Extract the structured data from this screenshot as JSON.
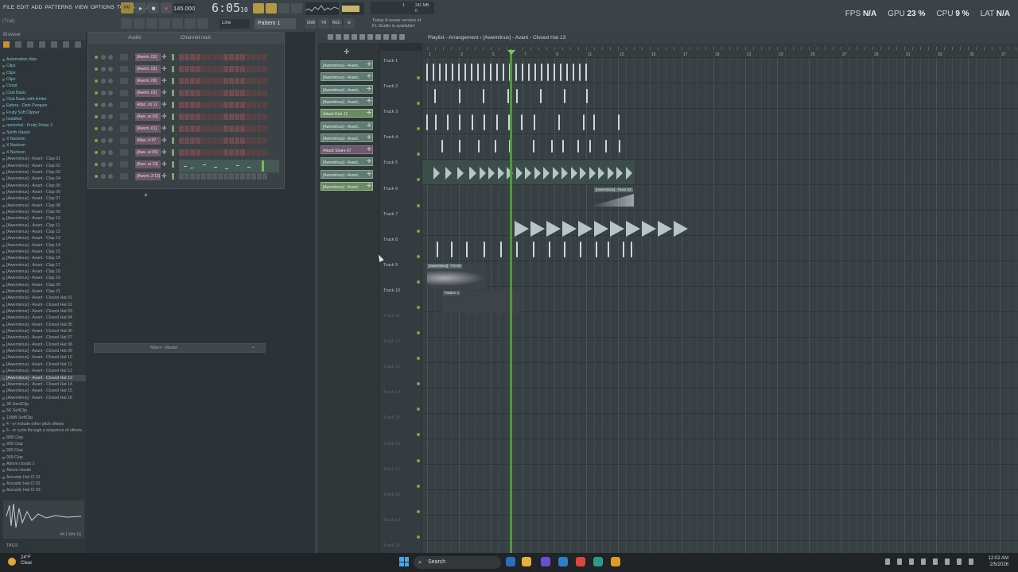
{
  "menu": [
    "FILE",
    "EDIT",
    "ADD",
    "PATTERNS",
    "VIEW",
    "OPTIONS",
    "TOOLS",
    "HELP"
  ],
  "hint": "(Trial)",
  "tempo": "145.000",
  "time_main": "6:05",
  "time_sub": "10",
  "cpu_voices": "1",
  "cpu_mem": "241 MB",
  "cpu_poly": "0",
  "line_mode": "Line",
  "pattern": "Pattern 1",
  "snap_labels": [
    "SNR",
    "TR",
    "REC"
  ],
  "notice_line1": "Today  A newer version of",
  "notice_line2": "FL Studio is available!",
  "stats": {
    "fps_label": "FPS",
    "fps": "N/A",
    "gpu_label": "GPU",
    "gpu": "23 %",
    "cpu_label": "CPU",
    "cpu": "9 %",
    "lat_label": "LAT",
    "lat": "N/A"
  },
  "browser": {
    "title": "Browser",
    "items": [
      {
        "t": "Automation clips",
        "k": "folder"
      },
      {
        "t": "Clips",
        "k": "folder"
      },
      {
        "t": "Clips",
        "k": "folder"
      },
      {
        "t": "Clips",
        "k": "folder"
      },
      {
        "t": "Cloud",
        "k": "folder"
      },
      {
        "t": "Club Basic",
        "k": "folder"
      },
      {
        "t": "Club Basic with limiter",
        "k": "folder"
      },
      {
        "t": "Eptera - Dark Penguin",
        "k": "folder"
      },
      {
        "t": "Fruity Soft Clipper",
        "k": "folder"
      },
      {
        "t": "Installed",
        "k": "folder"
      },
      {
        "t": "nocturnal - Fruity Delay 3",
        "k": "folder"
      },
      {
        "t": "Synth classic",
        "k": "folder"
      },
      {
        "t": "X Nucleon",
        "k": "folder"
      },
      {
        "t": "X Nucleon",
        "k": "folder"
      },
      {
        "t": "X Nucleon",
        "k": "folder"
      },
      {
        "t": "[Awemiinus] - Avant - Clap 01",
        "k": "file"
      },
      {
        "t": "[Awemiinus] - Avant - Clap 02",
        "k": "file"
      },
      {
        "t": "[Awemiinus] - Avant - Clap 03",
        "k": "file"
      },
      {
        "t": "[Awemiinus] - Avant - Clap 04",
        "k": "file"
      },
      {
        "t": "[Awemiinus] - Avant - Clap 05",
        "k": "file"
      },
      {
        "t": "[Awemiinus] - Avant - Clap 06",
        "k": "file"
      },
      {
        "t": "[Awemiinus] - Avant - Clap 07",
        "k": "file"
      },
      {
        "t": "[Awemiinus] - Avant - Clap 08",
        "k": "file"
      },
      {
        "t": "[Awemiinus] - Avant - Clap 09",
        "k": "file"
      },
      {
        "t": "[Awemiinus] - Avant - Clap 10",
        "k": "file"
      },
      {
        "t": "[Awemiinus] - Avant - Clap 11",
        "k": "file"
      },
      {
        "t": "[Awemiinus] - Avant - Clap 12",
        "k": "file"
      },
      {
        "t": "[Awemiinus] - Avant - Clap 13",
        "k": "file"
      },
      {
        "t": "[Awemiinus] - Avant - Clap 14",
        "k": "file"
      },
      {
        "t": "[Awemiinus] - Avant - Clap 15",
        "k": "file"
      },
      {
        "t": "[Awemiinus] - Avant - Clap 16",
        "k": "file"
      },
      {
        "t": "[Awemiinus] - Avant - Clap 17",
        "k": "file"
      },
      {
        "t": "[Awemiinus] - Avant - Clap 18",
        "k": "file"
      },
      {
        "t": "[Awemiinus] - Avant - Clap 19",
        "k": "file"
      },
      {
        "t": "[Awemiinus] - Avant - Clap 20",
        "k": "file"
      },
      {
        "t": "[Awemiinus] - Avant - Clap 21",
        "k": "file"
      },
      {
        "t": "[Awemiinus] - Avant - Closed Hat 01",
        "k": "file"
      },
      {
        "t": "[Awemiinus] - Avant - Closed Hat 02",
        "k": "file"
      },
      {
        "t": "[Awemiinus] - Avant - Closed Hat 03",
        "k": "file"
      },
      {
        "t": "[Awemiinus] - Avant - Closed Hat 04",
        "k": "file"
      },
      {
        "t": "[Awemiinus] - Avant - Closed Hat 05",
        "k": "file"
      },
      {
        "t": "[Awemiinus] - Avant - Closed Hat 06",
        "k": "file"
      },
      {
        "t": "[Awemiinus] - Avant - Closed Hat 07",
        "k": "file"
      },
      {
        "t": "[Awemiinus] - Avant - Closed Hat 08",
        "k": "file"
      },
      {
        "t": "[Awemiinus] - Avant - Closed Hat 09",
        "k": "file"
      },
      {
        "t": "[Awemiinus] - Avant - Closed Hat 10",
        "k": "file"
      },
      {
        "t": "[Awemiinus] - Avant - Closed Hat 11",
        "k": "file"
      },
      {
        "t": "[Awemiinus] - Avant - Closed Hat 12",
        "k": "file"
      },
      {
        "t": "[Awemiinus] - Avant - Closed Hat 13",
        "k": "sel"
      },
      {
        "t": "[Awemiinus] - Avant - Closed Hat 14",
        "k": "file"
      },
      {
        "t": "[Awemiinus] - Avant - Closed Hat 15",
        "k": "file"
      },
      {
        "t": "[Awemiinus] - Avant - Closed Hat 16",
        "k": "file"
      },
      {
        "t": "3K HardClip",
        "k": "file"
      },
      {
        "t": "5K SoftClip",
        "k": "file"
      },
      {
        "t": "10MB SoftClip",
        "k": "file"
      },
      {
        "t": "4 - or include other pitch offsets",
        "k": "file"
      },
      {
        "t": "5 - or cycle through a sequence of offsets",
        "k": "file"
      },
      {
        "t": "808 Clap",
        "k": "file"
      },
      {
        "t": "909 Clap",
        "k": "file"
      },
      {
        "t": "909 Clap",
        "k": "file"
      },
      {
        "t": "909 Clap",
        "k": "file"
      },
      {
        "t": "Above clouds 2",
        "k": "file"
      },
      {
        "t": "Above clouds",
        "k": "file"
      },
      {
        "t": "Acoustic Hat Cl 01",
        "k": "file"
      },
      {
        "t": "Acoustic Hat Cl 02",
        "k": "file"
      },
      {
        "t": "Acoustic Hat Cl 03",
        "k": "file"
      }
    ],
    "preview_label": "44.1 kHz 16",
    "tags_label": "TAGS"
  },
  "channel_rack": {
    "title": "Channel rack",
    "group": "Audio",
    "channels": [
      "[Awem..03]",
      "[Awem..09]",
      "[Awem..08]",
      "[Awem..02]",
      "Attac..ck 11",
      "[Awe..ar 02]",
      "[Awem..01]",
      "Attac..rt 07",
      "[Awe..at 05]",
      "[Awe..at 13]",
      "[Awem..3 13]"
    ]
  },
  "mixer_title": "Mixer - Master",
  "playlist": {
    "title": "Playlist - Arrangement",
    "breadcrumb": "[Awemiinus] - Avant - Closed Hat 13",
    "picker": [
      {
        "t": "[Awemiinus] - Avant..",
        "k": "pat"
      },
      {
        "t": "[Awemiinus] - Avant..",
        "k": "pat"
      },
      {
        "t": "[Awemiinus] - Avant..",
        "k": "pat"
      },
      {
        "t": "[Awemiinus] - Avant..",
        "k": "pat"
      },
      {
        "t": "Attack Kick 11",
        "k": "sel"
      },
      {
        "t": "[Awemiinus] - Avant..",
        "k": "pat"
      },
      {
        "t": "[Awemiinus] - Avant..",
        "k": "pat"
      },
      {
        "t": "Attack Snare 07",
        "k": "aud"
      },
      {
        "t": "[Awemiinus] - Avant..",
        "k": "pat"
      },
      {
        "t": "[Awemiinus] - Avant..",
        "k": "pat"
      },
      {
        "t": "[Awemiinus] - Avant..",
        "k": "sel"
      }
    ],
    "tracks": [
      "Track 1",
      "Track 2",
      "Track 3",
      "Track 4",
      "Track 5",
      "Track 6",
      "Track 7",
      "Track 8",
      "Track 9",
      "Track 10",
      "Track 11",
      "Track 12",
      "Track 13",
      "Track 14",
      "Track 15",
      "Track 16",
      "Track 17",
      "Track 18",
      "Track 19",
      "Track 20"
    ],
    "bar_numbers": [
      "1",
      "3",
      "5",
      "7",
      "9",
      "11",
      "13",
      "15",
      "17",
      "19",
      "21",
      "23",
      "25",
      "27",
      "29",
      "31",
      "33",
      "35",
      "37"
    ],
    "clip_label_riser": "[Awemiinus] - Riser 02",
    "clip_label_pattern": "Pattern 1",
    "clip_label_fx": "[Awemiinus] - FX 03"
  },
  "taskbar": {
    "temp": "24°F",
    "weather": "Clear",
    "search": "Search",
    "time": "12:02 AM",
    "date": "2/5/2026"
  }
}
